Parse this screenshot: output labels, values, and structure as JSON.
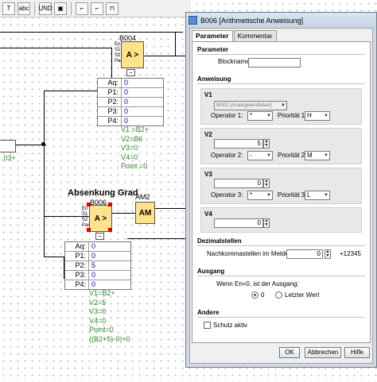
{
  "toolbar": {
    "buttons": [
      "T",
      "abc",
      "UND",
      "▣",
      "⌐",
      "⌐",
      "⊓"
    ]
  },
  "canvas": {
    "block_b004": {
      "id": "B004",
      "symbol": "A >",
      "pins": [
        "En",
        "S1",
        "S2",
        "Par"
      ]
    },
    "block_b006": {
      "id": "B006",
      "symbol": "A >",
      "pins": [
        "En",
        "S1",
        "S2",
        "Par"
      ]
    },
    "block_am2": {
      "id": "AM2",
      "symbol": "AM"
    },
    "heading": "Absenkung Grad",
    "left_value": ".03+",
    "table_b004": [
      {
        "k": "Aq:",
        "v": "0"
      },
      {
        "k": "P1:",
        "v": "0"
      },
      {
        "k": "P2:",
        "v": "0"
      },
      {
        "k": "P3:",
        "v": "0"
      },
      {
        "k": "P4:",
        "v": "0"
      }
    ],
    "table_b006": [
      {
        "k": "Aq:",
        "v": "0"
      },
      {
        "k": "P1:",
        "v": "0"
      },
      {
        "k": "P2:",
        "v": "5"
      },
      {
        "k": "P3:",
        "v": "0"
      },
      {
        "k": "P4:",
        "v": "0"
      }
    ],
    "formula_b004": [
      "V1 =B2+",
      "V2=B6",
      "V3=0",
      "V4=0",
      "Point =0"
    ],
    "formula_b006": [
      "V1=B2+",
      "V2=5",
      "V3=0",
      "V4=0",
      "Point=0",
      "((B2+5)-0)+0"
    ]
  },
  "dialog": {
    "title": "B006 [Arithmetische Anweisung]",
    "tabs": [
      "Parameter",
      "Kommentar"
    ],
    "active_tab": "Parameter",
    "sections": {
      "parameter": "Parameter",
      "anweisung": "Anweisung",
      "dezimalstellen": "Dezimalstellen",
      "ausgang": "Ausgang",
      "andere": "Andere"
    },
    "blockname_label": "Blockname:",
    "blockname_value": "",
    "v1": {
      "label": "V1",
      "source": "B002 [Analogverstärker]",
      "operator_label": "Operator 1:",
      "operator": "*",
      "prio_label": "Priorität 1:",
      "prio": "H"
    },
    "v2": {
      "label": "V2",
      "value": "5",
      "operator_label": "Operator 2:",
      "operator": "-",
      "prio_label": "Priorität 2:",
      "prio": "M"
    },
    "v3": {
      "label": "V3",
      "value": "0",
      "operator_label": "Operator 3:",
      "operator": "*",
      "prio_label": "Priorität 3:",
      "prio": "L"
    },
    "v4": {
      "label": "V4",
      "value": "0"
    },
    "decimal_label": "Nachkommastellen im Meldetext",
    "decimal_value": "0",
    "decimal_example": "+12345",
    "output_text": "Wenn En=0, ist der Ausgang:",
    "radio_zero": "0",
    "radio_last": "Letzter Wert",
    "protect_label": "Schutz aktiv",
    "buttons": {
      "ok": "OK",
      "cancel": "Abbrechen",
      "help": "Hilfe"
    }
  }
}
